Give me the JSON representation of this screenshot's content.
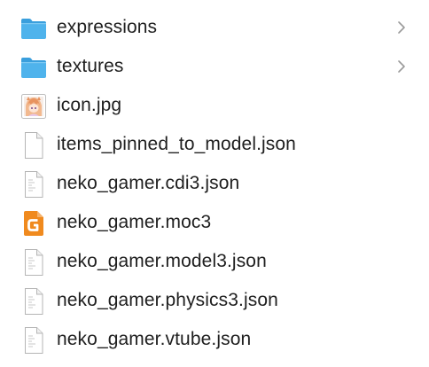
{
  "colors": {
    "folder": "#4fb3ec",
    "folder_tab": "#3a9fdd",
    "text": "#1f1f1f",
    "chevron": "#9a9a9a",
    "moc3_badge": "#f08a1e"
  },
  "items": [
    {
      "name": "expressions",
      "kind": "folder",
      "icon": "folder-icon",
      "has_disclosure": true
    },
    {
      "name": "textures",
      "kind": "folder",
      "icon": "folder-icon",
      "has_disclosure": true
    },
    {
      "name": "icon.jpg",
      "kind": "image",
      "icon": "image-thumbnail-icon",
      "has_disclosure": false
    },
    {
      "name": "items_pinned_to_model.json",
      "kind": "document",
      "icon": "blank-document-icon",
      "has_disclosure": false
    },
    {
      "name": "neko_gamer.cdi3.json",
      "kind": "document",
      "icon": "text-document-icon",
      "has_disclosure": false
    },
    {
      "name": "neko_gamer.moc3",
      "kind": "moc3",
      "icon": "moc3-file-icon",
      "has_disclosure": false
    },
    {
      "name": "neko_gamer.model3.json",
      "kind": "document",
      "icon": "text-document-icon",
      "has_disclosure": false
    },
    {
      "name": "neko_gamer.physics3.json",
      "kind": "document",
      "icon": "text-document-icon",
      "has_disclosure": false
    },
    {
      "name": "neko_gamer.vtube.json",
      "kind": "document",
      "icon": "text-document-icon",
      "has_disclosure": false
    }
  ]
}
